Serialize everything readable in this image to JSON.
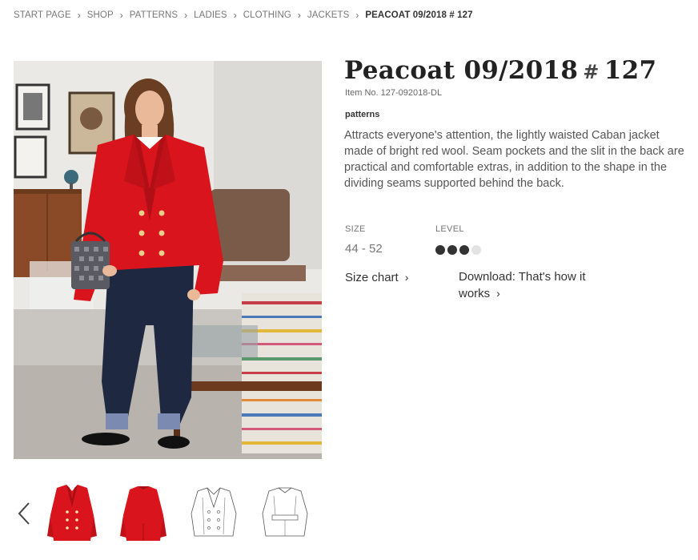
{
  "breadcrumb": [
    {
      "label": "START PAGE"
    },
    {
      "label": "SHOP"
    },
    {
      "label": "PATTERNS"
    },
    {
      "label": "LADIES"
    },
    {
      "label": "CLOTHING"
    },
    {
      "label": "JACKETS"
    },
    {
      "label": "PEACOAT 09/2018 # 127"
    }
  ],
  "product": {
    "title_main": "Peacoat 09/2018",
    "title_hash": "#",
    "title_num": "127",
    "item_no": "Item No. 127-092018-DL",
    "tag": "patterns",
    "description": "Attracts everyone's attention, the lightly waisted Caban jacket made of bright red wool. Seam pockets and the slit in the back are practical and comfortable extras, in addition to the shape in the dividing seams supported behind the back.",
    "size_label": "SIZE",
    "size_value": "44 - 52",
    "level_label": "LEVEL",
    "level": 3,
    "level_max": 4,
    "size_chart_link": "Size chart",
    "download_link": "Download: That's how it works"
  },
  "icons": {
    "breadcrumb_sep": "chevron-right-icon",
    "link_chevron": "chevron-right-icon",
    "prev": "chevron-left-icon"
  },
  "colors": {
    "coat_red": "#d9141d",
    "level_on": "#333333",
    "level_off": "#e2e2e2"
  }
}
